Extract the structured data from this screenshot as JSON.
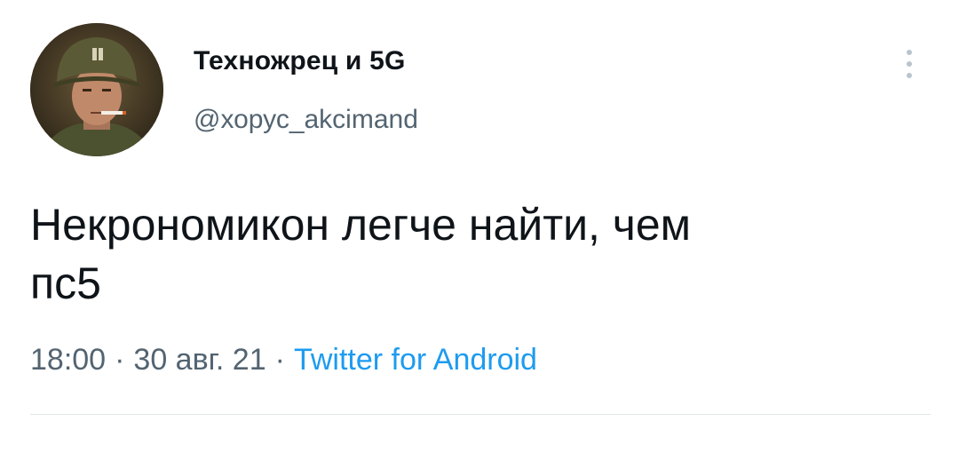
{
  "tweet": {
    "author": {
      "display_name": "Техножрец и 5G",
      "handle": "@хорус_akcimand"
    },
    "text": "Некрономикон легче найти, чем\nпс5",
    "time": "18:00",
    "date": "30 авг. 21",
    "separator": "·",
    "source": "Twitter for Android"
  },
  "icons": {
    "avatar": "avatar-photo-soldier-helmet",
    "more": "more-vertical-icon"
  },
  "colors": {
    "text_primary": "#0f1419",
    "text_secondary": "#536471",
    "link": "#1d9bf0",
    "divider": "#e1e6ea",
    "menu_dots": "#b9c4cc"
  }
}
